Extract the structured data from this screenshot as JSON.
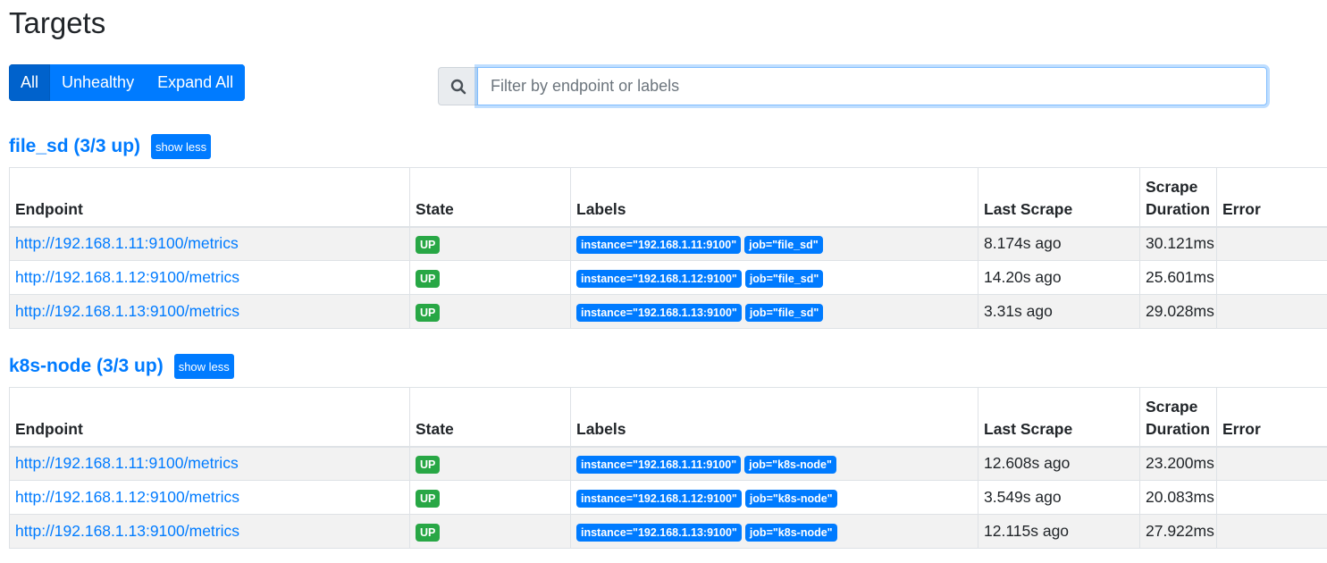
{
  "page": {
    "title": "Targets"
  },
  "filters": {
    "all": "All",
    "unhealthy": "Unhealthy",
    "expand_all": "Expand All"
  },
  "search": {
    "placeholder": "Filter by endpoint or labels",
    "icon": "search-icon"
  },
  "columns": [
    "Endpoint",
    "State",
    "Labels",
    "Last Scrape",
    "Scrape Duration",
    "Error"
  ],
  "colors": {
    "primary": "#007bff",
    "success": "#28a745",
    "row_stripe": "#f2f2f2"
  },
  "pools": [
    {
      "title": "file_sd (3/3 up)",
      "toggle": "show less",
      "rows": [
        {
          "endpoint": "http://192.168.1.11:9100/metrics",
          "state": "UP",
          "labels": [
            "instance=\"192.168.1.11:9100\"",
            "job=\"file_sd\""
          ],
          "last_scrape": "8.174s ago",
          "duration": "30.121ms",
          "error": ""
        },
        {
          "endpoint": "http://192.168.1.12:9100/metrics",
          "state": "UP",
          "labels": [
            "instance=\"192.168.1.12:9100\"",
            "job=\"file_sd\""
          ],
          "last_scrape": "14.20s ago",
          "duration": "25.601ms",
          "error": ""
        },
        {
          "endpoint": "http://192.168.1.13:9100/metrics",
          "state": "UP",
          "labels": [
            "instance=\"192.168.1.13:9100\"",
            "job=\"file_sd\""
          ],
          "last_scrape": "3.31s ago",
          "duration": "29.028ms",
          "error": ""
        }
      ]
    },
    {
      "title": "k8s-node (3/3 up)",
      "toggle": "show less",
      "rows": [
        {
          "endpoint": "http://192.168.1.11:9100/metrics",
          "state": "UP",
          "labels": [
            "instance=\"192.168.1.11:9100\"",
            "job=\"k8s-node\""
          ],
          "last_scrape": "12.608s ago",
          "duration": "23.200ms",
          "error": ""
        },
        {
          "endpoint": "http://192.168.1.12:9100/metrics",
          "state": "UP",
          "labels": [
            "instance=\"192.168.1.12:9100\"",
            "job=\"k8s-node\""
          ],
          "last_scrape": "3.549s ago",
          "duration": "20.083ms",
          "error": ""
        },
        {
          "endpoint": "http://192.168.1.13:9100/metrics",
          "state": "UP",
          "labels": [
            "instance=\"192.168.1.13:9100\"",
            "job=\"k8s-node\""
          ],
          "last_scrape": "12.115s ago",
          "duration": "27.922ms",
          "error": ""
        }
      ]
    }
  ]
}
